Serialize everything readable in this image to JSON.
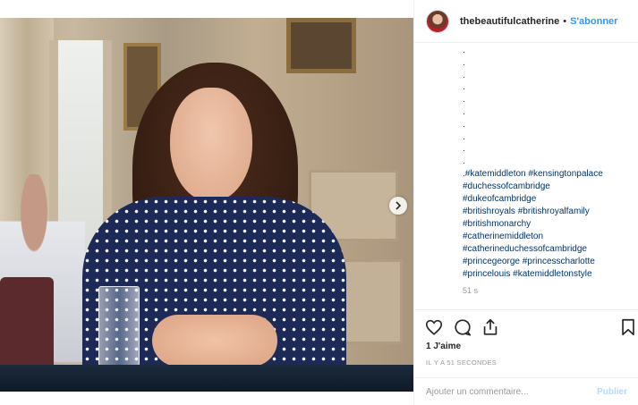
{
  "post": {
    "username": "thebeautifulcatherine",
    "separator": "•",
    "follow_label": "S'abonner",
    "next_icon": "chevron-right-icon",
    "caption_dots": [
      ".",
      ".",
      ".",
      ".",
      ".",
      ".",
      ".",
      ".",
      ".",
      "."
    ],
    "hashtag_lines": [
      ".#katemiddleton  #kensingtonpalace",
      "#duchessofcambridge",
      "#dukeofcambridge",
      "#britishroyals  #britishroyalfamily",
      "#britishmonarchy",
      "#catherinemiddleton",
      "#catherineduchessofcambridge",
      "#princegeorge  #princesscharlotte",
      "#princelouis  #katemiddletonstyle"
    ],
    "caption_time": "51 s",
    "likes": "1 J'aime",
    "timestamp": "IL Y A 51 SECONDES",
    "comment_placeholder": "Ajouter un commentaire...",
    "publish_label": "Publier"
  },
  "icons": [
    "heart-icon",
    "comment-icon",
    "share-icon",
    "bookmark-icon"
  ],
  "colors": {
    "link": "#3897f0",
    "hashtag": "#003569",
    "muted": "#999999",
    "publish_disabled": "#b3dbff"
  }
}
